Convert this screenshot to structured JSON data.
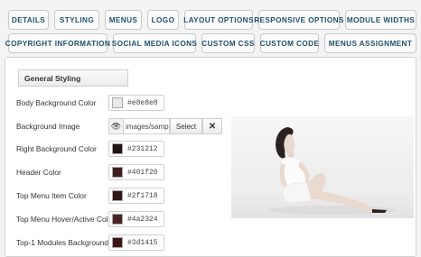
{
  "tabs": [
    "DETAILS",
    "STYLING",
    "MENUS",
    "LOGO",
    "LAYOUT OPTIONS",
    "RESPONSIVE OPTIONS",
    "MODULE WIDTHS",
    "COPYRIGHT INFORMATION",
    "SOCIAL MEDIA ICONS",
    "CUSTOM CSS",
    "CUSTOM CODE",
    "MENUS ASSIGNMENT"
  ],
  "section_title": "General Styling",
  "fields": [
    {
      "label": "Body Background Color",
      "value": "#e8e8e8",
      "swatch": "#e8e8e8"
    },
    {
      "label": "Background Image",
      "value": "images/sample",
      "select": "Select",
      "clear": "✕"
    },
    {
      "label": "Right Background Color",
      "value": "#231212",
      "swatch": "#231212"
    },
    {
      "label": "Header Color",
      "value": "#401f20",
      "swatch": "#401f20"
    },
    {
      "label": "Top Menu Item Color",
      "value": "#2f1718",
      "swatch": "#2f1718"
    },
    {
      "label": "Top Menu Hover/Active Color",
      "value": "#4a2324",
      "swatch": "#4a2324"
    },
    {
      "label": "Top-1 Modules Background",
      "value": "#3d1415",
      "swatch": "#3d1415"
    }
  ],
  "icons": {
    "preview": "eye-icon",
    "clear": "close-icon"
  }
}
